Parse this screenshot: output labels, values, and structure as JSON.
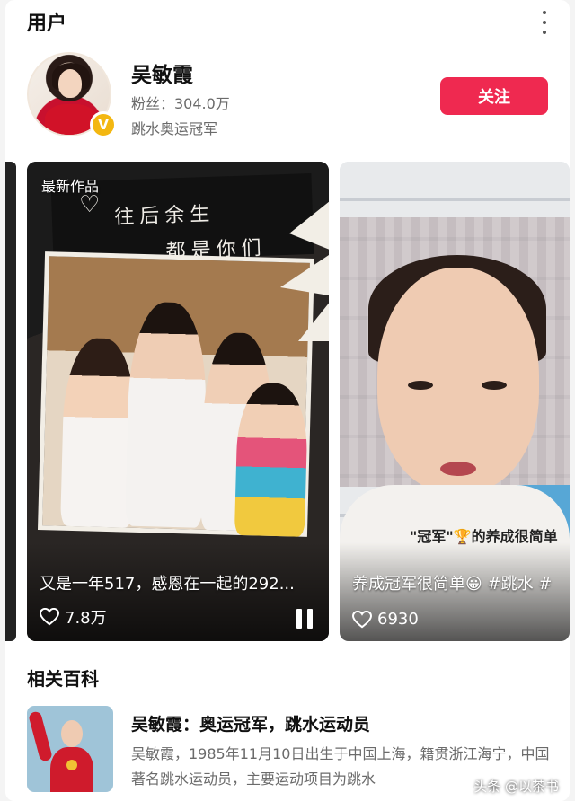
{
  "section": {
    "title": "用户"
  },
  "profile": {
    "name": "吴敏霞",
    "fans": "粉丝：304.0万",
    "description": "跳水奥运冠军",
    "follow_label": "关注",
    "verified_color": "#f3b711"
  },
  "videos": [
    {
      "badge": "最新作品",
      "handwriting": [
        "往后余生",
        "都是你们"
      ],
      "caption": "又是一年517，感恩在一起的292...",
      "likes": "7.8万",
      "icon": "heart-outline-icon",
      "control_icon": "pause-icon"
    },
    {
      "subtitle": "\"冠军\"🏆的养成很简单",
      "caption": "养成冠军很简单😀 #跳水 #",
      "likes": "6930",
      "icon": "heart-outline-icon"
    }
  ],
  "encyclopedia": {
    "title": "相关百科",
    "heading": "吴敏霞：奥运冠军，跳水运动员",
    "text": "吴敏霞，1985年11月10日出生于中国上海，籍贯浙江海宁，中国著名跳水运动员，主要运动项目为跳水"
  },
  "watermark": "头条 @以茶书",
  "colors": {
    "accent": "#ef2950",
    "background": "#f4f4f4"
  }
}
